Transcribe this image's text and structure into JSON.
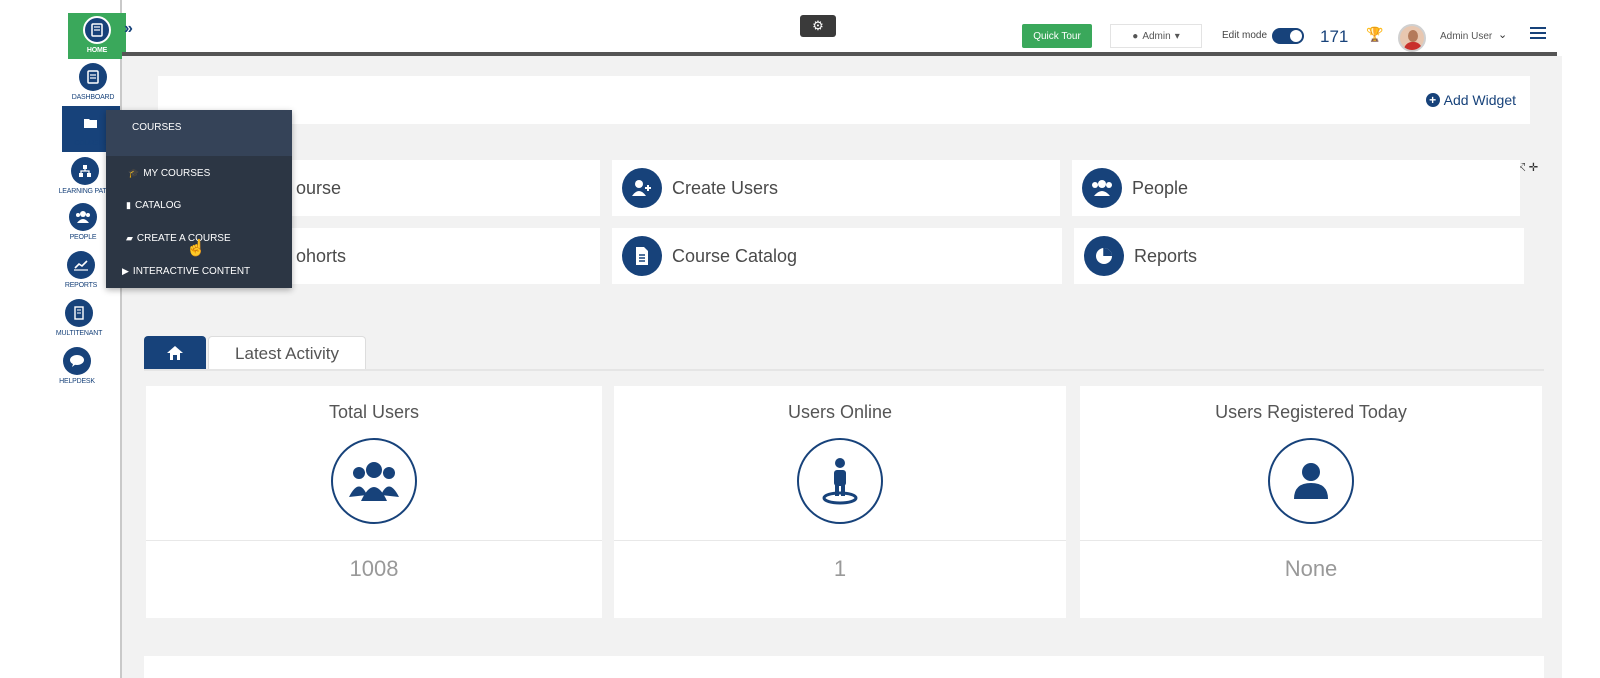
{
  "sidebar": {
    "items": [
      {
        "label": "HOME",
        "icon": "book-icon"
      },
      {
        "label": "DASHBOARD",
        "icon": "dashboard-icon"
      },
      {
        "label": "COURSES",
        "icon": "folder-open-icon"
      },
      {
        "label": "LEARNING PATH",
        "icon": "sitemap-icon"
      },
      {
        "label": "PEOPLE",
        "icon": "users-icon"
      },
      {
        "label": "REPORTS",
        "icon": "line-chart-icon"
      },
      {
        "label": "MULTITENANT",
        "icon": "building-icon"
      },
      {
        "label": "HELPDESK",
        "icon": "chat-bubble-icon"
      }
    ]
  },
  "courses_menu": {
    "title": "COURSES",
    "items": [
      {
        "label": "MY COURSES",
        "icon": "graduation-cap-icon"
      },
      {
        "label": "CATALOG",
        "icon": "file-icon"
      },
      {
        "label": "CREATE A COURSE",
        "icon": "book-icon"
      },
      {
        "label": "INTERACTIVE CONTENT",
        "icon": "play-icon"
      }
    ]
  },
  "topbar": {
    "quick_tour": "Quick Tour",
    "role": "Admin",
    "edit_mode_label": "Edit mode",
    "edit_mode_on": true,
    "points": "171",
    "user_name": "Admin User"
  },
  "widget_bar": {
    "add_widget": "Add Widget"
  },
  "shortcuts": [
    {
      "label": "ourse",
      "icon": "book-icon"
    },
    {
      "label": "Create Users",
      "icon": "user-plus-icon"
    },
    {
      "label": "People",
      "icon": "users-icon"
    },
    {
      "label": "ohorts",
      "icon": "group-icon"
    },
    {
      "label": "Course Catalog",
      "icon": "document-icon"
    },
    {
      "label": "Reports",
      "icon": "pie-chart-icon"
    }
  ],
  "tabs": {
    "home_icon": "home-icon",
    "latest_activity": "Latest Activity"
  },
  "stats": [
    {
      "title": "Total Users",
      "value": "1008",
      "icon": "users-group-icon"
    },
    {
      "title": "Users Online",
      "value": "1",
      "icon": "user-standing-icon"
    },
    {
      "title": "Users Registered Today",
      "value": "None",
      "icon": "user-icon"
    }
  ],
  "colors": {
    "brand": "#17427a",
    "accent_green": "#3aa85b",
    "menu_dark": "#2c3644"
  }
}
